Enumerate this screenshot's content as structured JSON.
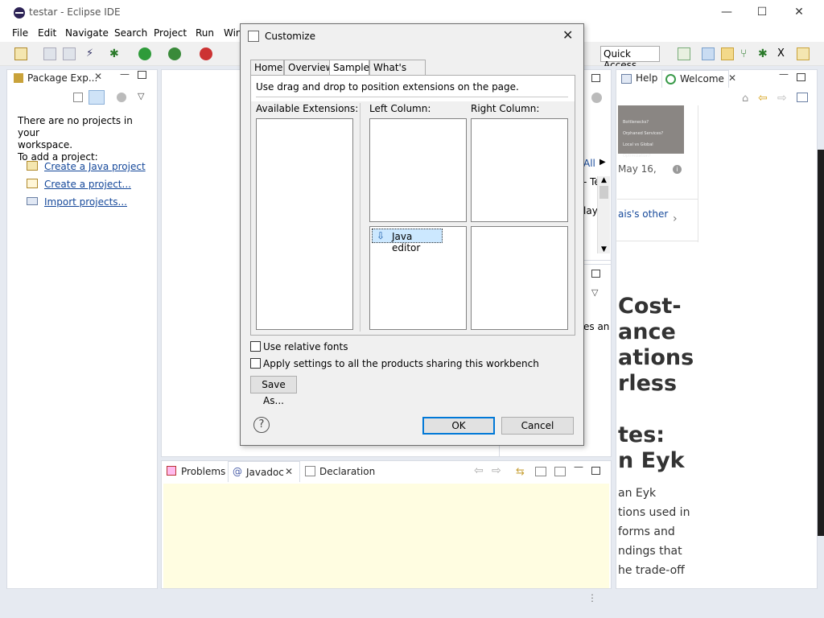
{
  "window": {
    "title": "testar - Eclipse IDE",
    "minimize": "—",
    "maximize": "☐",
    "close": "✕"
  },
  "menu": [
    "File",
    "Edit",
    "Navigate",
    "Search",
    "Project",
    "Run",
    "Win"
  ],
  "toolbar": {
    "quick_access": "Quick Access"
  },
  "package_explorer": {
    "tab_label": "Package Exp...",
    "message_line1": "There are no projects in your",
    "message_line2": "workspace.",
    "message_line3": "To add a project:",
    "links": [
      "Create a Java project",
      "Create a project...",
      "Import projects..."
    ]
  },
  "welcome": {
    "help_tab": "Help",
    "welcome_tab": "Welcome",
    "image_lines": [
      "Bottlenecks?",
      "Orphaned Services?",
      "Local vs Global Optimization?"
    ],
    "date": "May 16,",
    "related_link": "ais's other",
    "article_title": [
      "Cost-",
      "ance",
      "ations",
      "rless",
      "",
      "tes:",
      "n Eyk"
    ],
    "article_body": [
      "an Eyk",
      "tions used in",
      "forms and",
      "ndings that",
      "he trade-off"
    ]
  },
  "middle_fragments": {
    "all": "All",
    "te": "- Te",
    "lay": "lay",
    "es_an": "es an"
  },
  "bottom_panel": {
    "tabs": [
      "Problems",
      "Javadoc",
      "Declaration"
    ]
  },
  "dialog": {
    "title": "Customize",
    "tabs": [
      "Home",
      "Overview",
      "Samples",
      "What's New"
    ],
    "active_tab": "Samples",
    "instruction": "Use drag and drop to position extensions on the page.",
    "available_label": "Available Extensions:",
    "left_column_label": "Left Column:",
    "right_column_label": "Right Column:",
    "left_bottom_item": "Java editor",
    "use_relative_fonts": "Use relative fonts",
    "apply_all": "Apply settings to all the products sharing this workbench",
    "save_as": "Save As...",
    "ok": "OK",
    "cancel": "Cancel",
    "help_glyph": "?"
  }
}
